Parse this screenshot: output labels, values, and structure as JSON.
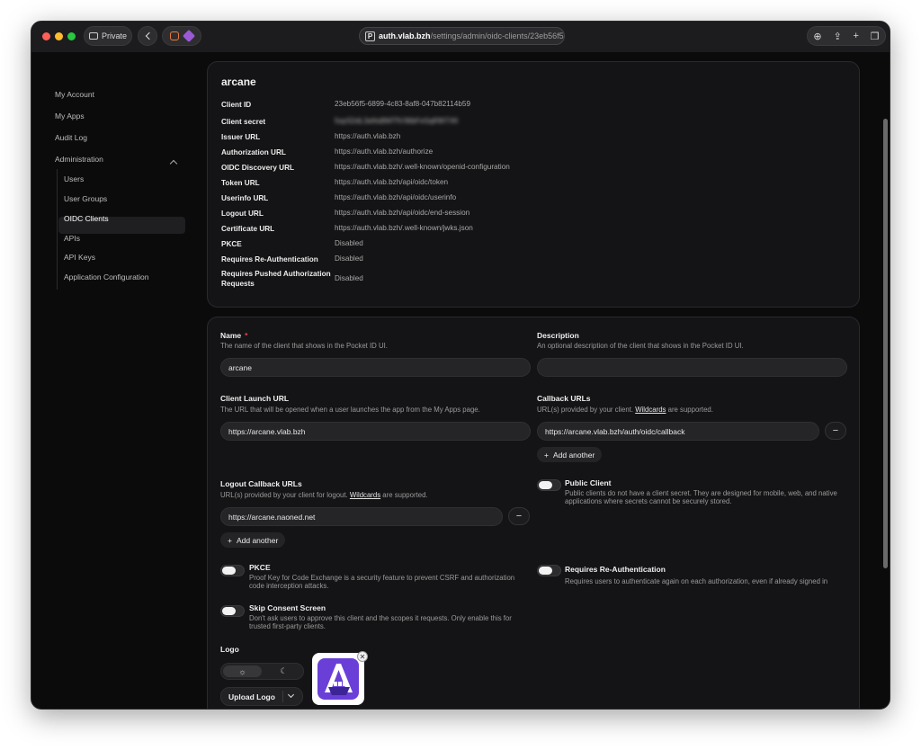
{
  "browser": {
    "private_label": "Private",
    "url_domain": "auth.vlab.bzh",
    "url_path": "/settings/admin/oidc-clients/23eb56f5"
  },
  "sidebar": {
    "my_account": "My Account",
    "my_apps": "My Apps",
    "audit_log": "Audit Log",
    "administration": "Administration",
    "sub_items": [
      "Users",
      "User Groups",
      "OIDC Clients",
      "APIs",
      "API Keys",
      "Application Configuration"
    ]
  },
  "info": {
    "title": "arcane",
    "rows": [
      {
        "k": "Client ID",
        "v": "23eb56f5-6899-4c83-8af8-047b82114b59"
      },
      {
        "k": "Client secret",
        "v": "5xpS2dL3aNsBMTfV36bFeSqR8iTXK"
      },
      {
        "k": "Issuer URL",
        "v": "https://auth.vlab.bzh"
      },
      {
        "k": "Authorization URL",
        "v": "https://auth.vlab.bzh/authorize"
      },
      {
        "k": "OIDC Discovery URL",
        "v": "https://auth.vlab.bzh/.well-known/openid-configuration"
      },
      {
        "k": "Token URL",
        "v": "https://auth.vlab.bzh/api/oidc/token"
      },
      {
        "k": "Userinfo URL",
        "v": "https://auth.vlab.bzh/api/oidc/userinfo"
      },
      {
        "k": "Logout URL",
        "v": "https://auth.vlab.bzh/api/oidc/end-session"
      },
      {
        "k": "Certificate URL",
        "v": "https://auth.vlab.bzh/.well-known/jwks.json"
      },
      {
        "k": "PKCE",
        "v": "Disabled"
      },
      {
        "k": "Requires Re-Authentication",
        "v": "Disabled"
      },
      {
        "k": "Requires Pushed Authorization Requests",
        "v": "Disabled"
      }
    ]
  },
  "form": {
    "name_label": "Name",
    "name_required": "*",
    "name_hint": "The name of the client that shows in the Pocket ID UI.",
    "name_value": "arcane",
    "desc_label": "Description",
    "desc_hint": "An optional description of the client that shows in the Pocket ID UI.",
    "desc_value": "",
    "launch_label": "Client Launch URL",
    "launch_hint": "The URL that will be opened when a user launches the app from the My Apps page.",
    "launch_value": "https://arcane.vlab.bzh",
    "callback_label": "Callback URLs",
    "callback_hint_pre": "URL(s) provided by your client.",
    "callback_hint_link": "Wildcards",
    "callback_hint_post": "are supported.",
    "callback_value": "https://arcane.vlab.bzh/auth/oidc/callback",
    "add_another": "Add another",
    "logout_label": "Logout Callback URLs",
    "logout_hint_pre": "URL(s) provided by your client for logout.",
    "logout_hint_link": "Wildcards",
    "logout_hint_post": "are supported.",
    "logout_value": "https://arcane.naoned.net",
    "public_label": "Public Client",
    "public_hint": "Public clients do not have a client secret. They are designed for mobile, web, and native applications where secrets cannot be securely stored.",
    "pkce_label": "PKCE",
    "pkce_hint": "Proof Key for Code Exchange is a security feature to prevent CSRF and authorization code interception attacks.",
    "reauth_label": "Requires Re-Authentication",
    "reauth_hint": "Requires users to authenticate again on each authorization, even if already signed in",
    "skip_label": "Skip Consent Screen",
    "skip_hint": "Don't ask users to approve this client and the scopes it requests. Only enable this for trusted first-party clients.",
    "logo_label": "Logo",
    "upload_label": "Upload Logo"
  }
}
